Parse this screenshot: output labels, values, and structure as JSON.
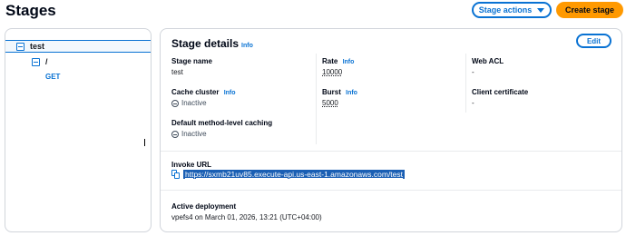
{
  "page": {
    "title": "Stages"
  },
  "header": {
    "stage_actions_label": "Stage actions",
    "create_stage_label": "Create stage"
  },
  "tree": {
    "stage": "test",
    "resource": "/",
    "method": "GET"
  },
  "details": {
    "title": "Stage details",
    "info": "Info",
    "edit_label": "Edit",
    "stage_name": {
      "label": "Stage name",
      "value": "test"
    },
    "rate": {
      "label": "Rate",
      "info": "Info",
      "value": "10000"
    },
    "web_acl": {
      "label": "Web ACL",
      "value": "-"
    },
    "cache_cluster": {
      "label": "Cache cluster",
      "info": "Info",
      "value": "Inactive"
    },
    "burst": {
      "label": "Burst",
      "info": "Info",
      "value": "5000"
    },
    "client_certificate": {
      "label": "Client certificate",
      "value": "-"
    },
    "default_caching": {
      "label": "Default method-level caching",
      "value": "Inactive"
    },
    "invoke_url": {
      "label": "Invoke URL",
      "value": "https://sxmb21uv85.execute-api.us-east-1.amazonaws.com/test"
    },
    "active_deployment": {
      "label": "Active deployment",
      "value": "vpefs4 on March 01, 2026, 13:21 (UTC+04:00)"
    }
  },
  "icons": {
    "expander": "collapse-square-icon",
    "inactive": "minus-circle-icon",
    "copy": "copy-icon",
    "dropdown": "caret-down-icon"
  },
  "colors": {
    "accent": "#0972d3",
    "primary_button": "#ff9900",
    "selection": "#1a5fb4"
  }
}
